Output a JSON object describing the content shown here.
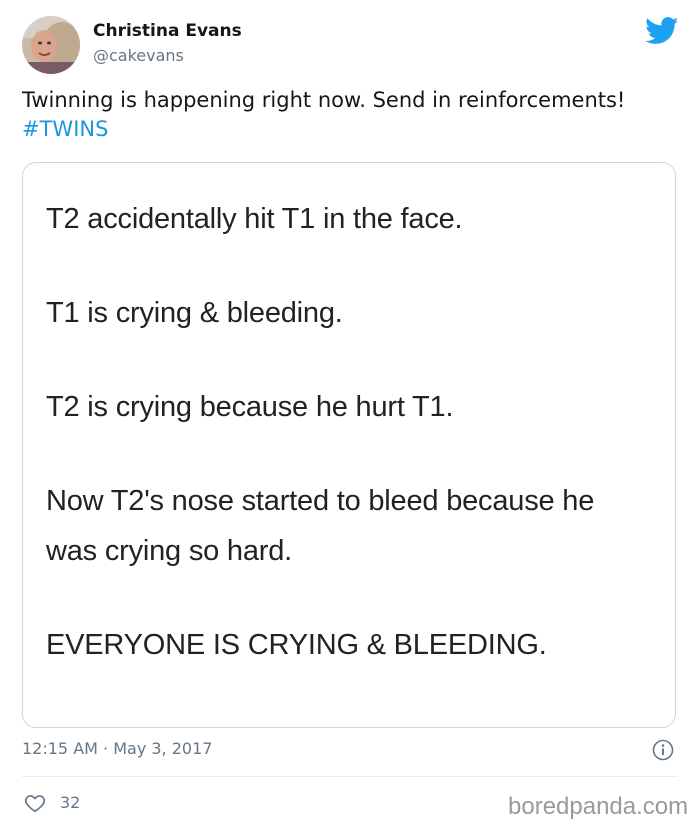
{
  "author": {
    "name": "Christina Evans",
    "handle": "@cakevans"
  },
  "tweet": {
    "text_main": "Twinning is happening right now. Send in reinforcements! ",
    "hashtag": "#TWINS"
  },
  "media": {
    "lines": [
      "T2 accidentally hit T1 in the face.",
      "T1 is crying & bleeding.",
      "T2 is crying because he hurt T1.",
      "Now T2's nose started to bleed because he",
      "was crying so hard.",
      "EVERYONE IS CRYING & BLEEDING."
    ]
  },
  "meta": {
    "timestamp": "12:15 AM · May 3, 2017"
  },
  "actions": {
    "likes": "32"
  },
  "watermark": "boredpanda.com",
  "colors": {
    "twitter_blue": "#1da1f2",
    "hashtag": "#1b95e0",
    "secondary_text": "#657786"
  }
}
